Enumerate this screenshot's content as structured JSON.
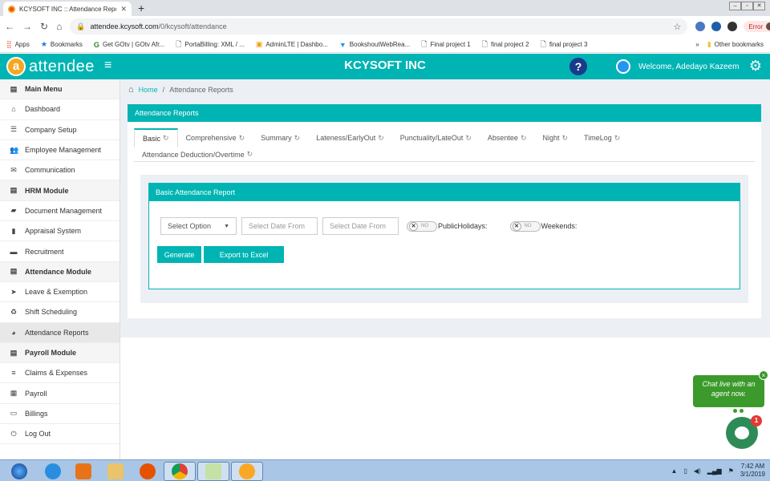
{
  "browser": {
    "tab_title": "KCYSOFT INC :: Attendance Repo",
    "url_domain": "attendee.kcysoft.com",
    "url_path": "/0/kcysoft/attendance",
    "error_label": "Error",
    "bookmarks": [
      "Apps",
      "Bookmarks",
      "Get GOtv | GOtv Afr...",
      "PortaBilling: XML / ...",
      "AdminLTE | Dashbo...",
      "BookshoutWebRea...",
      "Final project 1",
      "final project 2",
      "final project 3"
    ],
    "other_bookmarks": "Other bookmarks",
    "overflow": "»"
  },
  "header": {
    "logo_mark": "a",
    "logo_text": "attendee",
    "company": "KCYSOFT INC",
    "help": "?",
    "welcome": "Welcome, Adedayo Kazeem"
  },
  "sidebar": {
    "items": [
      {
        "label": "Main Menu",
        "icon": "list-icon",
        "glyph": "▤",
        "section": true
      },
      {
        "label": "Dashboard",
        "icon": "home-icon",
        "glyph": "⌂",
        "section": false
      },
      {
        "label": "Company Setup",
        "icon": "bars-icon",
        "glyph": "☰",
        "section": false
      },
      {
        "label": "Employee Management",
        "icon": "users-icon",
        "glyph": "👥",
        "section": false
      },
      {
        "label": "Communication",
        "icon": "envelope-icon",
        "glyph": "✉",
        "section": false
      },
      {
        "label": "HRM Module",
        "icon": "list-icon",
        "glyph": "▤",
        "section": true
      },
      {
        "label": "Document Management",
        "icon": "book-icon",
        "glyph": "▰",
        "section": false
      },
      {
        "label": "Appraisal System",
        "icon": "bookmark-icon",
        "glyph": "▮",
        "section": false
      },
      {
        "label": "Recruitment",
        "icon": "briefcase-icon",
        "glyph": "▬",
        "section": false
      },
      {
        "label": "Attendance Module",
        "icon": "list-icon",
        "glyph": "▤",
        "section": true
      },
      {
        "label": "Leave & Exemption",
        "icon": "send-icon",
        "glyph": "➤",
        "section": false
      },
      {
        "label": "Shift Scheduling",
        "icon": "recycle-icon",
        "glyph": "♻",
        "section": false
      },
      {
        "label": "Attendance Reports",
        "icon": "pie-chart-icon",
        "glyph": "◕",
        "section": false,
        "active": true
      },
      {
        "label": "Payroll Module",
        "icon": "list-icon",
        "glyph": "▤",
        "section": true
      },
      {
        "label": "Claims & Expenses",
        "icon": "bars-icon",
        "glyph": "≡",
        "section": false
      },
      {
        "label": "Payroll",
        "icon": "calculator-icon",
        "glyph": "▦",
        "section": false
      },
      {
        "label": "Billings",
        "icon": "money-icon",
        "glyph": "▭",
        "section": false
      },
      {
        "label": "Log Out",
        "icon": "power-icon",
        "glyph": "⏻",
        "section": false
      }
    ]
  },
  "breadcrumb": {
    "home": "Home",
    "sep": "/",
    "current": "Attendance Reports"
  },
  "card": {
    "title": "Attendance Reports",
    "tabs": [
      "Basic",
      "Comprehensive",
      "Summary",
      "Lateness/EarlyOut",
      "Punctuality/LateOut",
      "Absentee",
      "Night",
      "TimeLog"
    ],
    "tabs_row2": [
      "Attendance Deduction/Overtime"
    ],
    "active_tab": "Basic"
  },
  "report": {
    "title": "Basic Attendance Report",
    "select_label": "Select Option",
    "date_from_1": "Select Date From",
    "date_from_2": "Select Date From",
    "toggle_off": "NO",
    "public_holidays_label": "PublicHolidays:",
    "weekends_label": "Weekends:",
    "generate_label": "Generate",
    "export_label": "Export to Excel"
  },
  "chat": {
    "message": "Chat live with an agent now.",
    "badge": "1",
    "close": "×"
  },
  "taskbar": {
    "time": "7:42 AM",
    "date": "3/1/2019"
  },
  "colors": {
    "accent": "#00b4b4",
    "chat_green": "#3c9a2c",
    "badge_red": "#e53935"
  }
}
